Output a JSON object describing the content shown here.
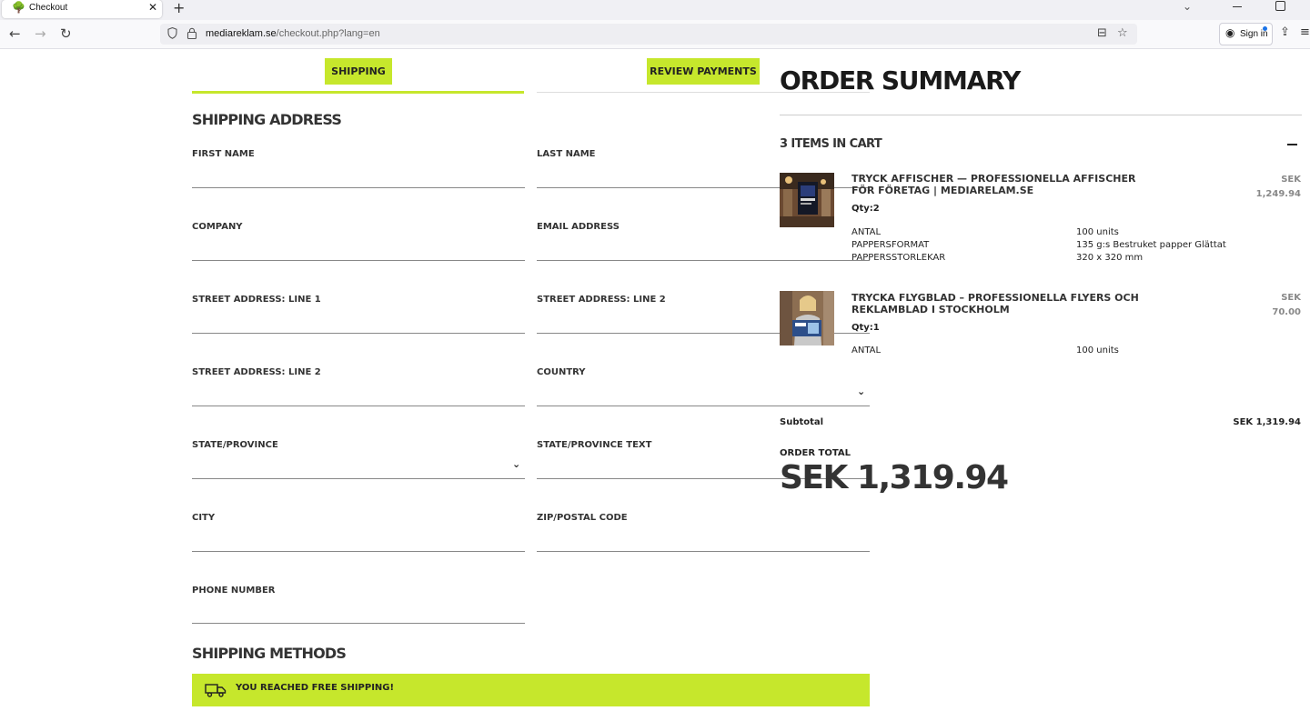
{
  "browser": {
    "tab_title": "Checkout",
    "url_host": "mediareklam.se",
    "url_path": "/checkout.php?lang=en",
    "signin_label": "Sign in"
  },
  "steps": {
    "shipping": "SHIPPING",
    "review": "REVIEW PAYMENTS",
    "accent_color": "#c6e72c"
  },
  "form": {
    "title": "SHIPPING ADDRESS",
    "first_name": "FIRST NAME",
    "last_name": "LAST NAME",
    "company": "COMPANY",
    "email": "EMAIL ADDRESS",
    "street1": "STREET ADDRESS: LINE 1",
    "street2": "STREET ADDRESS: LINE 2",
    "street2b": "STREET ADDRESS: LINE 2",
    "country": "COUNTRY",
    "state": "STATE/PROVINCE",
    "state_text": "STATE/PROVINCE TEXT",
    "city": "CITY",
    "zip": "ZIP/POSTAL CODE",
    "phone": "PHONE NUMBER"
  },
  "shipping_methods": {
    "title": "SHIPPING METHODS",
    "free_message": "YOU REACHED FREE SHIPPING!"
  },
  "summary": {
    "title": "ORDER SUMMARY",
    "items_count": "3 ITEMS IN CART",
    "items": [
      {
        "name": "TRYCK AFFISCHER — PROFESSIONELLA AFFISCHER FÖR FÖRETAG | MEDIARELAM.SE",
        "qty": "Qty:2",
        "currency": "SEK",
        "price": "1,249.94",
        "options": [
          {
            "k": "ANTAL",
            "v": "100 units"
          },
          {
            "k": "PAPPERSFORMAT",
            "v": "135 g:s Bestruket papper Glättat"
          },
          {
            "k": "PAPPERSSTORLEKAR",
            "v": "320 x 320 mm"
          }
        ]
      },
      {
        "name": "TRYCKA FLYGBLAD – PROFESSIONELLA FLYERS OCH REKLAMBLAD I STOCKHOLM",
        "qty": "Qty:1",
        "currency": "SEK",
        "price": "70.00",
        "options": [
          {
            "k": "ANTAL",
            "v": "100 units"
          }
        ]
      }
    ],
    "subtotal_label": "Subtotal",
    "subtotal_value": "SEK 1,319.94",
    "order_total_label": "ORDER TOTAL",
    "order_total_value": "SEK 1,319.94"
  }
}
